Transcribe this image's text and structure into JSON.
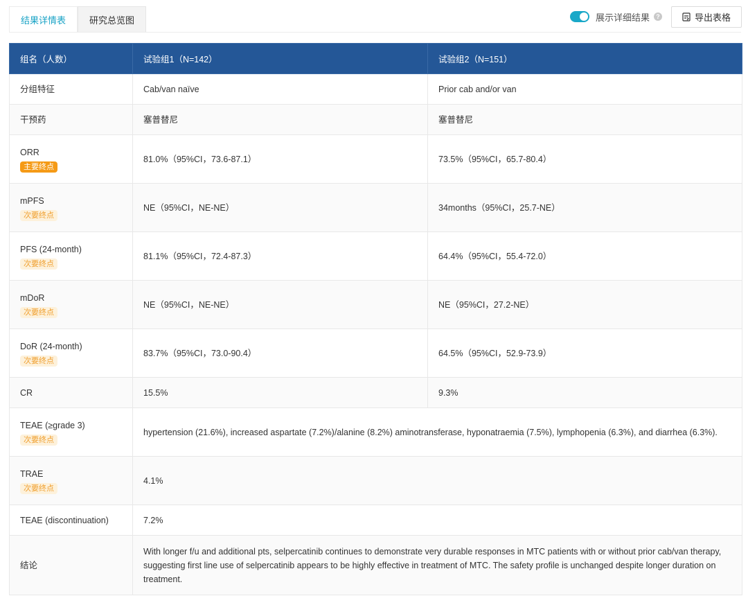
{
  "tabs": [
    {
      "label": "结果详情表",
      "active": true
    },
    {
      "label": "研究总览图",
      "active": false
    }
  ],
  "toggle": {
    "label": "展示详细结果",
    "on": true,
    "help": "?"
  },
  "export": {
    "label": "导出表格"
  },
  "colors": {
    "header_bg": "#245797",
    "accent": "#1aa3c6",
    "primary_badge": "#f59a16",
    "secondary_badge_text": "#f0a030"
  },
  "table": {
    "headers": [
      "组名（人数）",
      "试验组1（N=142）",
      "试验组2（N=151）"
    ],
    "rows": [
      {
        "label": "分组特征",
        "badge": "",
        "g1": "Cab/van naïve",
        "g2": "Prior cab and/or van"
      },
      {
        "label": "干预药",
        "badge": "",
        "g1": "塞普替尼",
        "g2": "塞普替尼"
      },
      {
        "label": "ORR",
        "badge": "主要终点",
        "g1": "81.0%（95%CI，73.6-87.1）",
        "g2": "73.5%（95%CI，65.7-80.4）"
      },
      {
        "label": "mPFS",
        "badge": "次要终点",
        "g1": "NE（95%CI，NE-NE）",
        "g2": "34months（95%CI，25.7-NE）"
      },
      {
        "label": "PFS (24-month)",
        "badge": "次要终点",
        "g1": "81.1%（95%CI，72.4-87.3）",
        "g2": "64.4%（95%CI，55.4-72.0）"
      },
      {
        "label": "mDoR",
        "badge": "次要终点",
        "g1": "NE（95%CI，NE-NE）",
        "g2": "NE（95%CI，27.2-NE）"
      },
      {
        "label": "DoR (24-month)",
        "badge": "次要终点",
        "g1": "83.7%（95%CI，73.0-90.4）",
        "g2": "64.5%（95%CI，52.9-73.9）"
      },
      {
        "label": "CR",
        "badge": "",
        "g1": "15.5%",
        "g2": "9.3%"
      },
      {
        "label": "TEAE (≥grade 3)",
        "badge": "次要终点",
        "merged": "hypertension (21.6%), increased aspartate (7.2%)/alanine (8.2%) aminotransferase, hyponatraemia (7.5%), lymphopenia (6.3%), and diarrhea (6.3%)."
      },
      {
        "label": "TRAE",
        "badge": "次要终点",
        "merged": "4.1%"
      },
      {
        "label": "TEAE (discontinuation)",
        "badge": "",
        "merged": "7.2%"
      },
      {
        "label": "结论",
        "badge": "",
        "merged": "With longer f/u and additional pts, selpercatinib continues to demonstrate very durable responses in MTC patients with or without prior cab/van therapy, suggesting first line use of selpercatinib appears to be highly effective in treatment of MTC. The safety profile is unchanged despite longer duration on treatment."
      }
    ]
  }
}
